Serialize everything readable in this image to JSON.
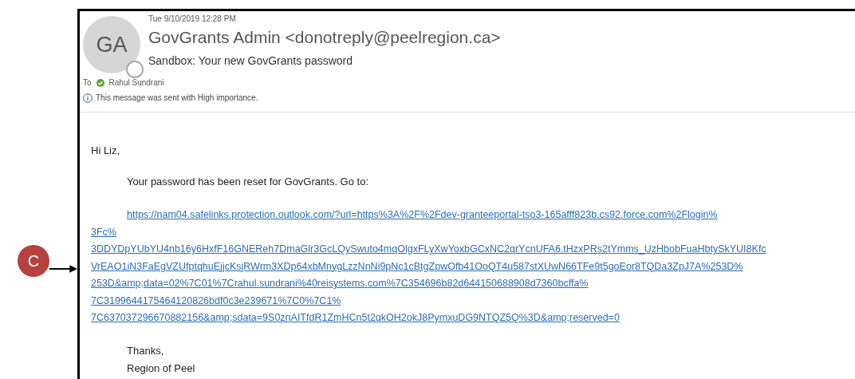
{
  "callout": {
    "label": "C"
  },
  "email": {
    "avatar": "GA",
    "date": "Tue 9/10/2019 12:28 PM",
    "sender": "GovGrants Admin <donotreply@peelregion.ca>",
    "subject": "Sandbox: Your new GovGrants password",
    "to_label": "To",
    "recipient": "Rahul Sundrani",
    "notice": "This message was sent with High importance."
  },
  "body": {
    "greeting": "Hi Liz,",
    "intro": "Your password has been reset for GovGrants. Go to:",
    "link_lines": [
      "https://nam04.safelinks.protection.outlook.com/?url=https%3A%2F%2Fdev-granteeportal-tso3-165afff823b.cs92.force.com%2Flogin%",
      "3Fc%",
      "3DDYDpYUbYU4nb16y6HxfF16GNEReh7DmaGlr3GcLQySwuto4mqOlgxFLyXwYoxbGCxNC2qrYcnUFA6.tHzxPRs2tYmms_UzHbobFuaHbtySkYUI8Kfc",
      "VrEAO1iN3FaEgVZUfptqhuEjjcKsjRWrm3XDp64xbMnygLzzNnNi9pNc1cBtgZpwOfb41OoQT4u587stXUwN66TFe9t5goEor8TQDa3ZpJ7A%253D%",
      "253D&amp;data=02%7C01%7Crahul.sundrani%40reisystems.com%7C354696b82d644150688908d7360bcffa%",
      "7C3199644175464120826bdf0c3e239671%7C0%7C1%",
      "7C637037296670882156&amp;sdata=9S0znAITfdR1ZmHCn5t2qkOH2okJ8PymxuDG9NTQZ5Q%3D&amp;reserved=0"
    ],
    "signoff": "Thanks,",
    "signature": "Region of Peel"
  }
}
